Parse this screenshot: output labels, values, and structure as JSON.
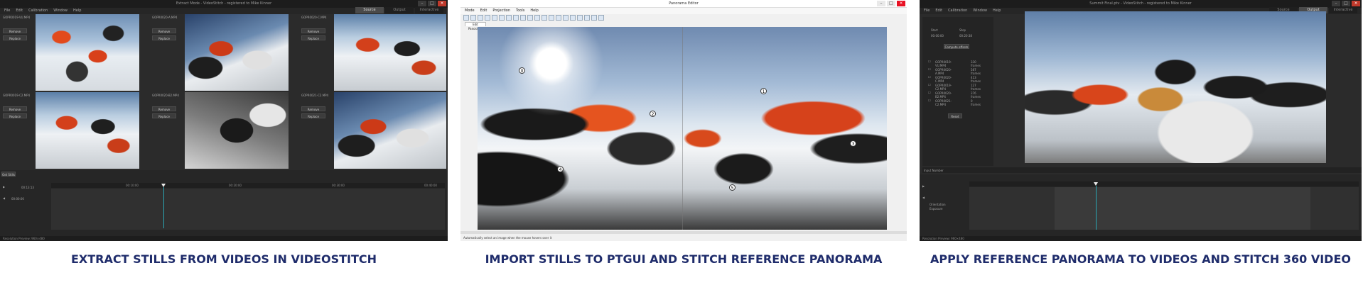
{
  "panel_extract": {
    "title": "Extract Mode - VideoStitch - registered to Mike Kinner",
    "menu": [
      "File",
      "Edit",
      "Calibration",
      "Window",
      "Help"
    ],
    "mode_tabs": [
      "Source",
      "Output",
      "Interactive"
    ],
    "tiles": [
      {
        "file": "GOPR0019-VU.MP4",
        "btn1": "Remove",
        "btn2": "Replace"
      },
      {
        "file": "GOPR0020-A.MP4",
        "btn1": "Remove",
        "btn2": "Replace"
      },
      {
        "file": "GOPR0020-C.MP4",
        "btn1": "Remove",
        "btn2": "Replace"
      },
      {
        "file": "GOPR0019-C2.MP4",
        "btn1": "Remove",
        "btn2": "Replace"
      },
      {
        "file": "GOPR0020-B2.MP4",
        "btn1": "Remove",
        "btn2": "Replace"
      },
      {
        "file": "GOPR0021-C2.MP4",
        "btn1": "Remove",
        "btn2": "Replace"
      }
    ],
    "get_stills": "Get Stills",
    "time_start": "00:00:00",
    "time_end": "00:13:13",
    "time_labels": [
      "00:10:00",
      "00:20:00",
      "00:30:00",
      "00:40:00"
    ],
    "status": "Resolution Preview: 960×480"
  },
  "panel_ptgui": {
    "title": "Panorama Editor",
    "menu": [
      "Mode",
      "Edit",
      "Projection",
      "Tools",
      "Help"
    ],
    "tab": "Edit Panorama",
    "points": [
      "0",
      "1",
      "2",
      "3",
      "4",
      "5"
    ],
    "status": "Automatically select an image when the mouse hovers over it"
  },
  "panel_apply": {
    "title": "Summit Final.ptv - VideoStitch - registered to Mike Kinner",
    "menu": [
      "File",
      "Edit",
      "Calibration",
      "Window",
      "Help"
    ],
    "mode_tabs": [
      "Source",
      "Output",
      "Interactive"
    ],
    "start_label": "Start",
    "stop_label": "Stop",
    "start_time": "00:00:00",
    "stop_time": "00:20:38",
    "compute_btn": "Compute offsets",
    "rows": [
      {
        "name": "GOPR0019-VU.MP4",
        "frames": "330 frames"
      },
      {
        "name": "GOPR0020-A.MP4",
        "frames": "587 frames"
      },
      {
        "name": "GOPR0020-C.MP4",
        "frames": "413 frames"
      },
      {
        "name": "GOPR0019-C2.MP4",
        "frames": "127 frames"
      },
      {
        "name": "GOPR0020-B2.MP4",
        "frames": "376 frames"
      },
      {
        "name": "GOPR0021-C2.MP4",
        "frames": "0 frames"
      }
    ],
    "reset_btn": "Reset",
    "input_number": "Input Number",
    "timeline_left": "Orientation",
    "timeline_left2": "Exposure",
    "status": "Resolution Preview: 960×480"
  },
  "captions": [
    "EXTRACT STILLS FROM VIDEOS IN VIDEOSTITCH",
    "IMPORT STILLS TO PTGUI AND STITCH REFERENCE PANORAMA",
    "APPLY REFERENCE PANORAMA TO VIDEOS AND STITCH 360 VIDEO"
  ],
  "colors": {
    "caption": "#1f2c6b",
    "playhead": "#2aa7b4"
  }
}
